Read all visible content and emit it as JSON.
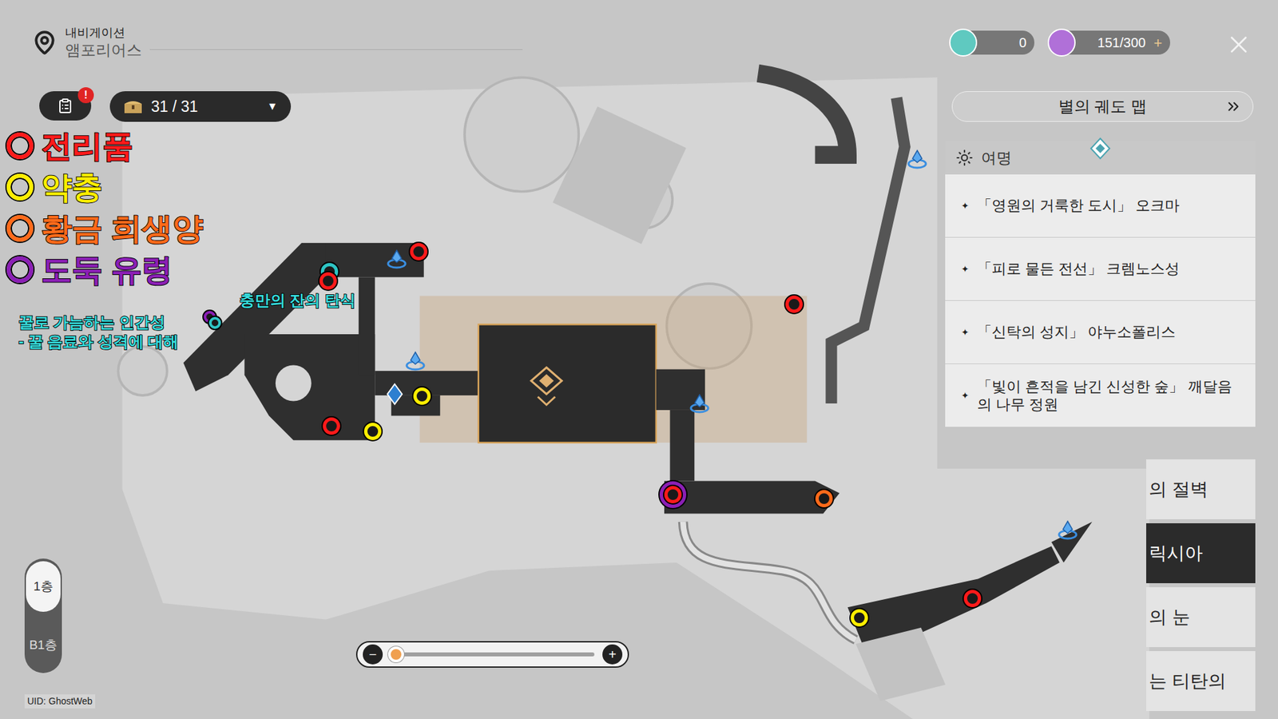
{
  "header": {
    "title": "내비게이션",
    "location": "앰포리어스"
  },
  "currencies": [
    {
      "value": "0",
      "action": ""
    },
    {
      "value": "151/300",
      "action": "+"
    }
  ],
  "quest_badge": "!",
  "chest_counter": {
    "value": "31 / 31",
    "dropdown": "▼"
  },
  "legend": [
    {
      "label": "전리품",
      "color": "#ff1a1a"
    },
    {
      "label": "약충",
      "color": "#ffee00"
    },
    {
      "label": "황금 희생양",
      "color": "#ff6a1a"
    },
    {
      "label": "도둑 유령",
      "color": "#8b1fb5"
    }
  ],
  "annotations": [
    {
      "lines": [
        "충만의 잔의 탄식"
      ]
    },
    {
      "lines": [
        "꿀로 가늠하는 인간성",
        "- 꿀 음료와 성격에 대해"
      ]
    }
  ],
  "pins": [
    {
      "kind": "marker",
      "color": "#ff1a1a"
    },
    {
      "kind": "marker",
      "color": "#2ec4c4"
    },
    {
      "kind": "marker",
      "color": "#ff1a1a"
    },
    {
      "kind": "marker",
      "color": "#ff1a1a"
    },
    {
      "kind": "marker",
      "color": "#ffee00"
    },
    {
      "kind": "marker",
      "color": "#ff1a1a"
    },
    {
      "kind": "marker",
      "color": "#ffee00"
    },
    {
      "kind": "halo",
      "color": "#8b1fb5"
    },
    {
      "kind": "marker",
      "color": "#ff1a1a"
    },
    {
      "kind": "marker",
      "color": "#ff6a1a"
    },
    {
      "kind": "marker",
      "color": "#ff1a1a"
    },
    {
      "kind": "marker",
      "color": "#ffee00"
    },
    {
      "kind": "small",
      "color": "#8b1fb5"
    },
    {
      "kind": "small",
      "color": "#2ec4c4"
    }
  ],
  "star_rail_map": {
    "title": "별의 궤도 맵"
  },
  "region": {
    "title": "여명",
    "bullet": "✦",
    "items": [
      {
        "label": "「영원의 거룩한 도시」 오크마",
        "selected": false
      },
      {
        "label": "「피로 물든 전선」 크렘노스성",
        "selected": false
      },
      {
        "label": "「신탁의 성지」 야누소폴리스",
        "selected": false
      },
      {
        "label": "「빛이 흔적을 남긴 신성한 숲」 깨달음의 나무 정원",
        "selected": false
      }
    ]
  },
  "worlds": [
    {
      "label": "의 절벽",
      "selected": false
    },
    {
      "label": "릭시아",
      "selected": true
    },
    {
      "label": "의 눈",
      "selected": false
    },
    {
      "label": "는 티탄의",
      "selected": false
    }
  ],
  "floors": [
    {
      "label": "1층",
      "selected": true
    },
    {
      "label": "B1층",
      "selected": false
    }
  ],
  "zoom": {
    "level": 0.0,
    "minus": "−",
    "plus": "+"
  },
  "uid": {
    "label": "UID:",
    "value": "GhostWeb"
  }
}
